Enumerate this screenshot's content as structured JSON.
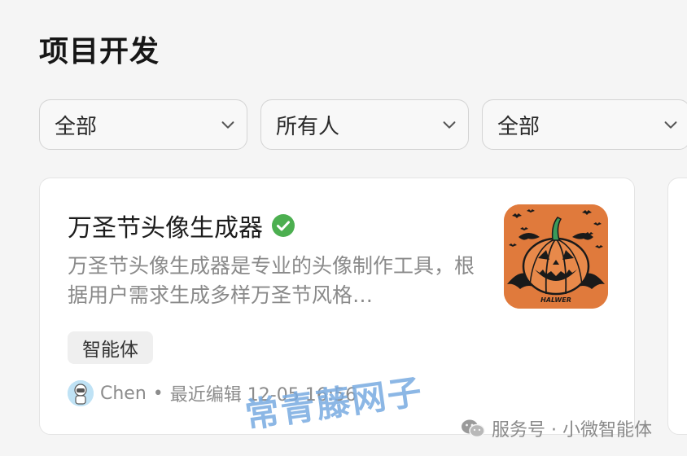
{
  "page": {
    "title": "项目开发"
  },
  "filters": [
    {
      "label": "全部"
    },
    {
      "label": "所有人"
    },
    {
      "label": "全部"
    }
  ],
  "card": {
    "title": "万圣节头像生成器",
    "verified_icon": "check-circle-icon",
    "description": "万圣节头像生成器是专业的头像制作工具，根据用户需求生成多样万圣节风格…",
    "thumbnail_text": "HALWER",
    "tag": "智能体",
    "author": "Chen",
    "separator": "•",
    "edited": "最近编辑 12-05 16:56"
  },
  "watermark": {
    "text": "常青藤网子"
  },
  "footer_mark": {
    "text": "服务号 · 小微智能体",
    "icon": "wechat-icon"
  },
  "colors": {
    "verified": "#4caf50",
    "thumb_bg": "#e07a3c",
    "pumpkin_stem": "#3a9b5a"
  }
}
